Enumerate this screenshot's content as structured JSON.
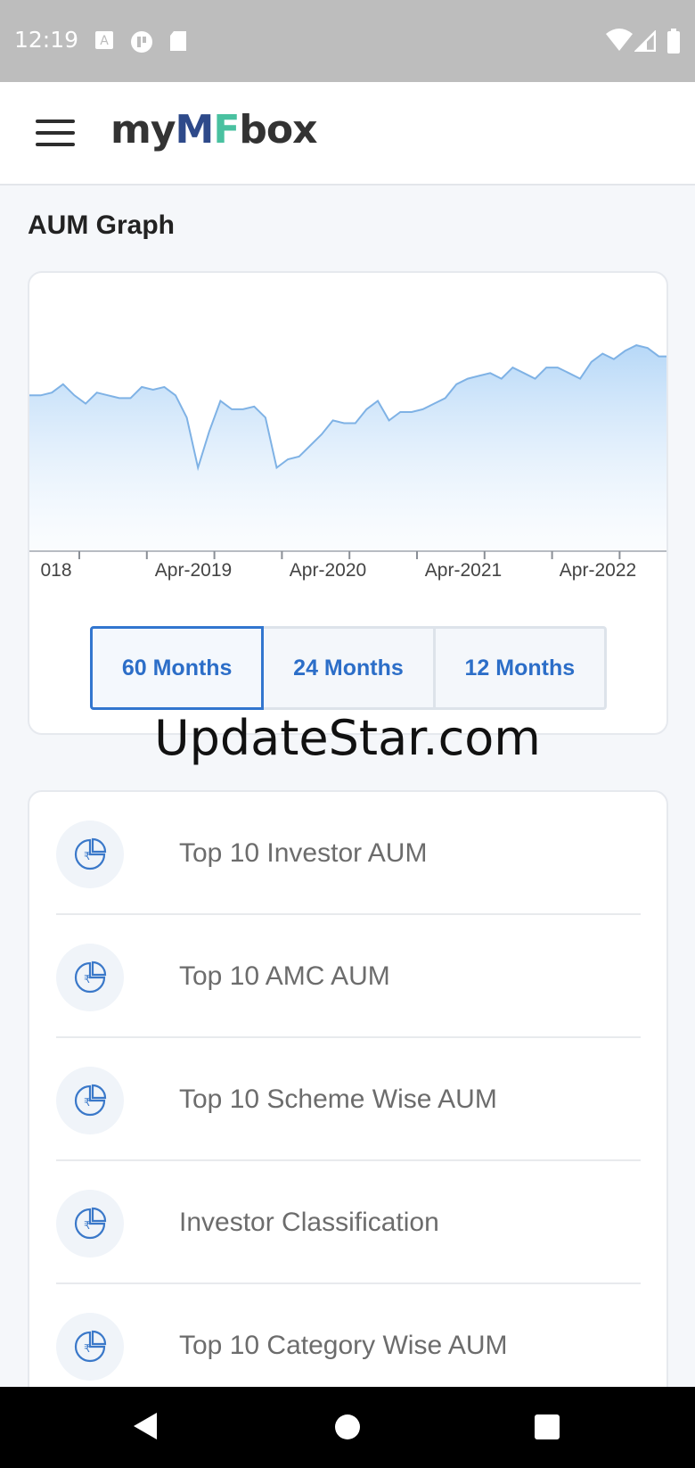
{
  "status_bar": {
    "time": "12:19",
    "left_icons": [
      "translate-a-icon",
      "pocket-icon",
      "sd-card-icon"
    ],
    "right_icons": [
      "wifi-icon",
      "signal-icon",
      "battery-icon"
    ]
  },
  "app_bar": {
    "logo_pre": "my",
    "logo_m": "M",
    "logo_f": "F",
    "logo_post": "box",
    "colors": {
      "m": "#2e4a8a",
      "f": "#49c1a0"
    }
  },
  "section_title": "AUM Graph",
  "chart_data": {
    "type": "area",
    "title": "",
    "xlabel": "",
    "ylabel": "",
    "x_tick_labels": [
      "018",
      "Apr-2019",
      "Apr-2020",
      "Apr-2021",
      "Apr-2022"
    ],
    "y_axis_shown": false,
    "grid": false,
    "series": [
      {
        "values": [
          56,
          56,
          57,
          60,
          56,
          53,
          57,
          56,
          55,
          55,
          59,
          58,
          59,
          56,
          48,
          30,
          43,
          54,
          51,
          51,
          52,
          48,
          30,
          33,
          34,
          38,
          42,
          47,
          46,
          46,
          51,
          54,
          47,
          50,
          50,
          51,
          53,
          55,
          60,
          62,
          63,
          64,
          62,
          66,
          64,
          62,
          66,
          66,
          64,
          62,
          68,
          71,
          69,
          72,
          74,
          73,
          70,
          70
        ],
        "color": "#7fb2e5"
      }
    ],
    "ylim": [
      0,
      100
    ]
  },
  "period_buttons": [
    {
      "label": "60 Months",
      "active": true
    },
    {
      "label": "24 Months",
      "active": false
    },
    {
      "label": "12 Months",
      "active": false
    }
  ],
  "watermark": "UpdateStar.com",
  "menu_items": [
    {
      "label": "Top 10 Investor AUM",
      "icon": "rupee-pie-icon"
    },
    {
      "label": "Top 10 AMC AUM",
      "icon": "rupee-pie-icon"
    },
    {
      "label": "Top 10 Scheme Wise AUM",
      "icon": "rupee-pie-icon"
    },
    {
      "label": "Investor Classification",
      "icon": "rupee-pie-icon"
    },
    {
      "label": "Top 10 Category Wise AUM",
      "icon": "rupee-pie-icon"
    }
  ],
  "nav_bar": [
    "back-icon",
    "home-icon",
    "recents-icon"
  ]
}
